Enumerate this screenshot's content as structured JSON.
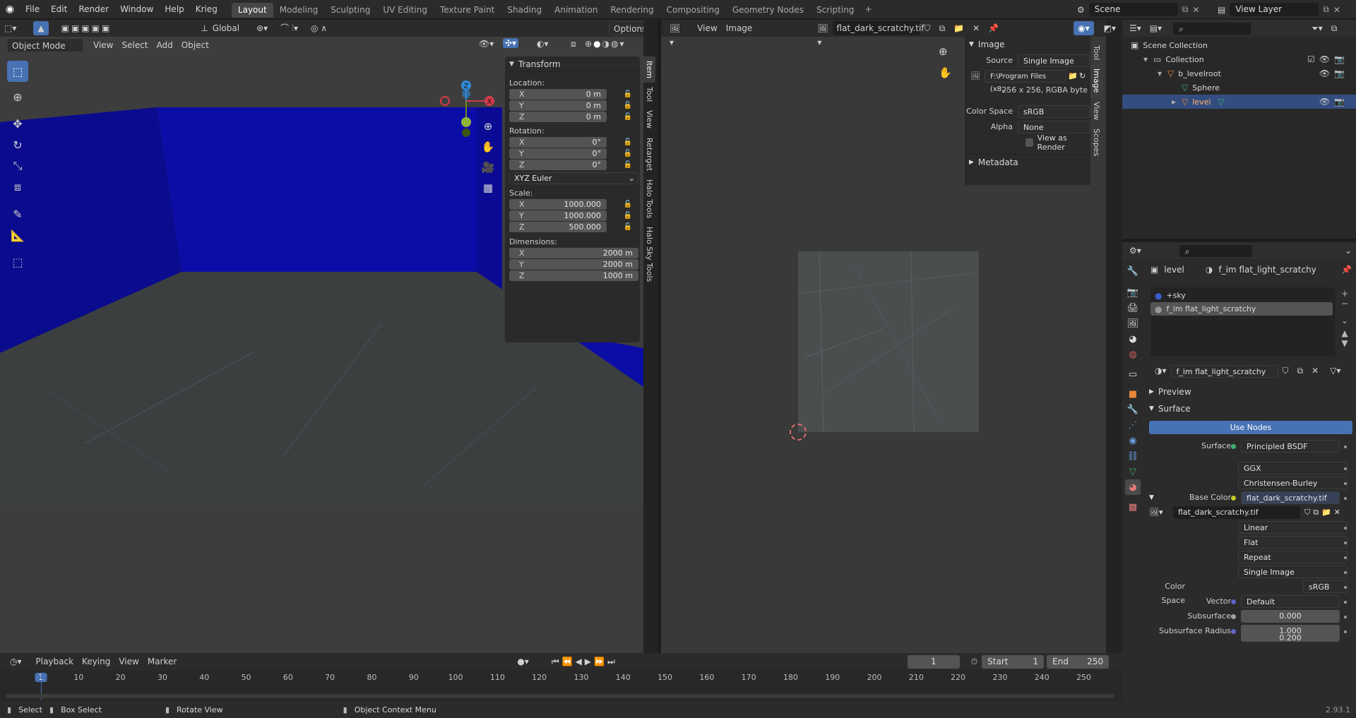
{
  "app": {
    "logo": "blender-logo"
  },
  "menu": [
    "File",
    "Edit",
    "Render",
    "Window",
    "Help",
    "Krieg"
  ],
  "workspaces": [
    "Layout",
    "Modeling",
    "Sculpting",
    "UV Editing",
    "Texture Paint",
    "Shading",
    "Animation",
    "Rendering",
    "Compositing",
    "Geometry Nodes",
    "Scripting"
  ],
  "active_workspace": "Layout",
  "scene": {
    "name": "Scene",
    "view_layer": "View Layer"
  },
  "viewport": {
    "toolbar1": {
      "orientation": "Global",
      "options": "Options"
    },
    "header": {
      "mode": "Object Mode",
      "menus": [
        "View",
        "Select",
        "Add",
        "Object"
      ]
    },
    "colors": {
      "wall": "#0c0ca6",
      "floor": "#3c3f40"
    },
    "npanel": {
      "title": "Transform",
      "location_label": "Location:",
      "location": [
        {
          "axis": "X",
          "value": "0 m"
        },
        {
          "axis": "Y",
          "value": "0 m"
        },
        {
          "axis": "Z",
          "value": "0 m"
        }
      ],
      "rotation_label": "Rotation:",
      "rotation": [
        {
          "axis": "X",
          "value": "0°"
        },
        {
          "axis": "Y",
          "value": "0°"
        },
        {
          "axis": "Z",
          "value": "0°"
        }
      ],
      "rotation_mode": "XYZ Euler",
      "scale_label": "Scale:",
      "scale": [
        {
          "axis": "X",
          "value": "1000.000"
        },
        {
          "axis": "Y",
          "value": "1000.000"
        },
        {
          "axis": "Z",
          "value": "500.000"
        }
      ],
      "dimensions_label": "Dimensions:",
      "dimensions": [
        {
          "axis": "X",
          "value": "2000 m"
        },
        {
          "axis": "Y",
          "value": "2000 m"
        },
        {
          "axis": "Z",
          "value": "1000 m"
        }
      ]
    },
    "side_tabs": [
      "Item",
      "Tool",
      "View",
      "Retarget",
      "Halo Tools",
      "Halo Sky Tools"
    ],
    "gizmo": {
      "z": "Z",
      "x": "X"
    }
  },
  "image_editor": {
    "menus": [
      "View",
      "Image"
    ],
    "image_name": "flat_dark_scratchy.tif",
    "panel": {
      "title": "Image",
      "source_label": "Source",
      "source": "Single Image",
      "path": "F:\\Program Files (x8...",
      "info": "256 x 256,  RGBA byte",
      "colorspace_label": "Color Space",
      "colorspace": "sRGB",
      "alpha_label": "Alpha",
      "alpha": "None",
      "view_as_render": "View as Render",
      "metadata": "Metadata"
    },
    "side_tabs": [
      "Tool",
      "Image",
      "View",
      "Scopes"
    ]
  },
  "outliner": {
    "search_placeholder": "",
    "items": [
      {
        "label": "Scene Collection",
        "indent": 0
      },
      {
        "label": "Collection",
        "indent": 1
      },
      {
        "label": "b_levelroot",
        "indent": 2
      },
      {
        "label": "Sphere",
        "indent": 3
      },
      {
        "label": "level",
        "indent": 3,
        "selected": true
      }
    ]
  },
  "properties": {
    "object": "level",
    "material": "f_im flat_light_scratchy",
    "slots": [
      "+sky",
      "f_im flat_light_scratchy"
    ],
    "active_material": "f_im flat_light_scratchy",
    "sections": {
      "preview": "Preview",
      "surface": "Surface"
    },
    "use_nodes": "Use Nodes",
    "surface_label": "Surface",
    "surface": "Principled BSDF",
    "distribution": "GGX",
    "subsurface_method": "Christensen-Burley",
    "base_color_label": "Base Color",
    "base_color": "flat_dark_scratchy.tif",
    "image": "flat_dark_scratchy.tif",
    "interpolation": "Linear",
    "projection": "Flat",
    "extension": "Repeat",
    "source": "Single Image",
    "colorspace_label": "Color Space",
    "colorspace": "sRGB",
    "vector_label": "Vector",
    "vector": "Default",
    "subsurface_label": "Subsurface",
    "subsurface": "0.000",
    "subsurface_radius_label": "Subsurface Radius",
    "subsurface_radius": "1.000",
    "subsurface_radius2": "0.200"
  },
  "timeline": {
    "menus": [
      "Playback",
      "Keying",
      "View",
      "Marker"
    ],
    "current_frame": "1",
    "start_label": "Start",
    "start": "1",
    "end_label": "End",
    "end": "250",
    "ticks": [
      "1",
      "10",
      "20",
      "30",
      "40",
      "50",
      "60",
      "70",
      "80",
      "90",
      "100",
      "110",
      "120",
      "130",
      "140",
      "150",
      "160",
      "170",
      "180",
      "190",
      "200",
      "210",
      "220",
      "230",
      "240",
      "250"
    ]
  },
  "statusbar": {
    "select": "Select",
    "box_select": "Box Select",
    "rotate": "Rotate View",
    "context": "Object Context Menu",
    "version": "2.93.1"
  }
}
